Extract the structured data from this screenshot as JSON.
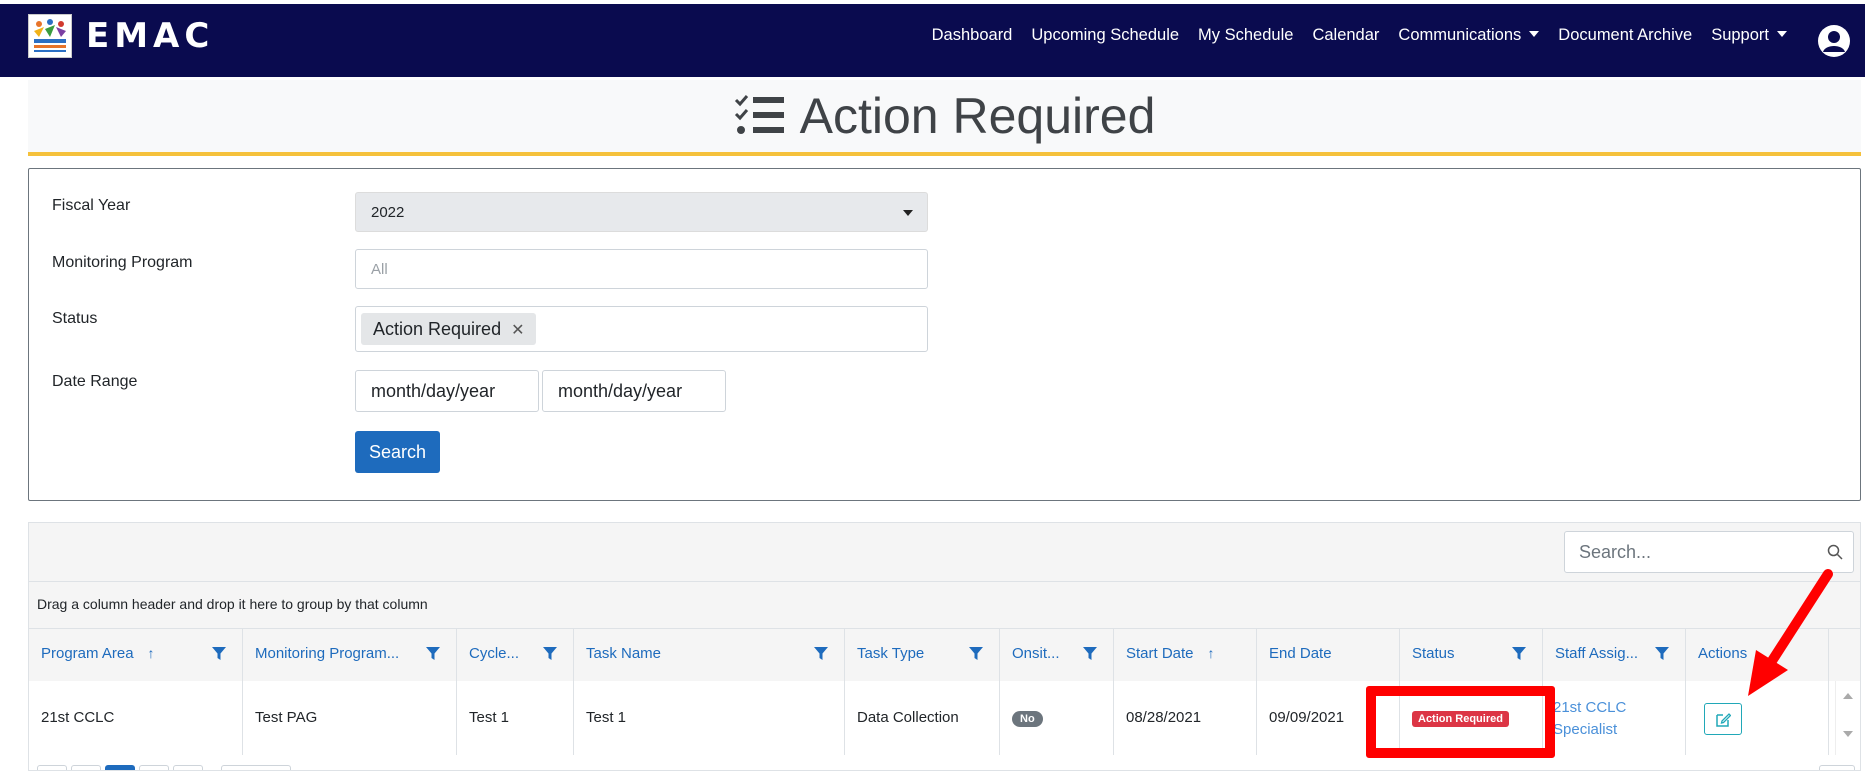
{
  "nav": {
    "brand": "EMAC",
    "links": [
      "Dashboard",
      "Upcoming Schedule",
      "My Schedule",
      "Calendar",
      "Communications",
      "Document Archive",
      "Support"
    ],
    "dropdown_links": [
      "Communications",
      "Support"
    ]
  },
  "page": {
    "title": "Action Required"
  },
  "filters": {
    "fiscal_year_label": "Fiscal Year",
    "fiscal_year_value": "2022",
    "monitoring_program_label": "Monitoring Program",
    "monitoring_program_placeholder": "All",
    "status_label": "Status",
    "status_chip": "Action Required",
    "date_range_label": "Date Range",
    "date_start_placeholder": "month/day/year",
    "date_end_placeholder": "month/day/year",
    "search_button": "Search"
  },
  "grid": {
    "search_placeholder": "Search...",
    "group_panel_text": "Drag a column header and drop it here to group by that column",
    "columns": [
      "Program Area",
      "Monitoring Program...",
      "Cycle...",
      "Task Name",
      "Task Type",
      "Onsit...",
      "Start Date",
      "End Date",
      "Status",
      "Staff Assig...",
      "Actions"
    ],
    "rows": [
      {
        "program_area": "21st CCLC",
        "monitoring_program": "Test PAG",
        "cycle": "Test 1",
        "task_name": "Test 1",
        "task_type": "Data Collection",
        "onsite": "No",
        "start_date": "08/28/2021",
        "end_date": "09/09/2021",
        "status": "Action Required",
        "staff_line1": "21st CCLC",
        "staff_line2": "Specialist"
      }
    ]
  },
  "colors": {
    "navbar": "#0a0b4f",
    "accent_yellow": "#f5c13b",
    "primary_blue": "#1e6bbd",
    "danger_red": "#dc3545",
    "annotation_red": "#ff0000",
    "teal_outline": "#20a8b8"
  },
  "icons": {
    "title": "list-check-icon",
    "user": "user-circle-icon",
    "grid_search": "search-icon",
    "column_filter": "funnel-icon",
    "edit_action": "edit-icon"
  }
}
